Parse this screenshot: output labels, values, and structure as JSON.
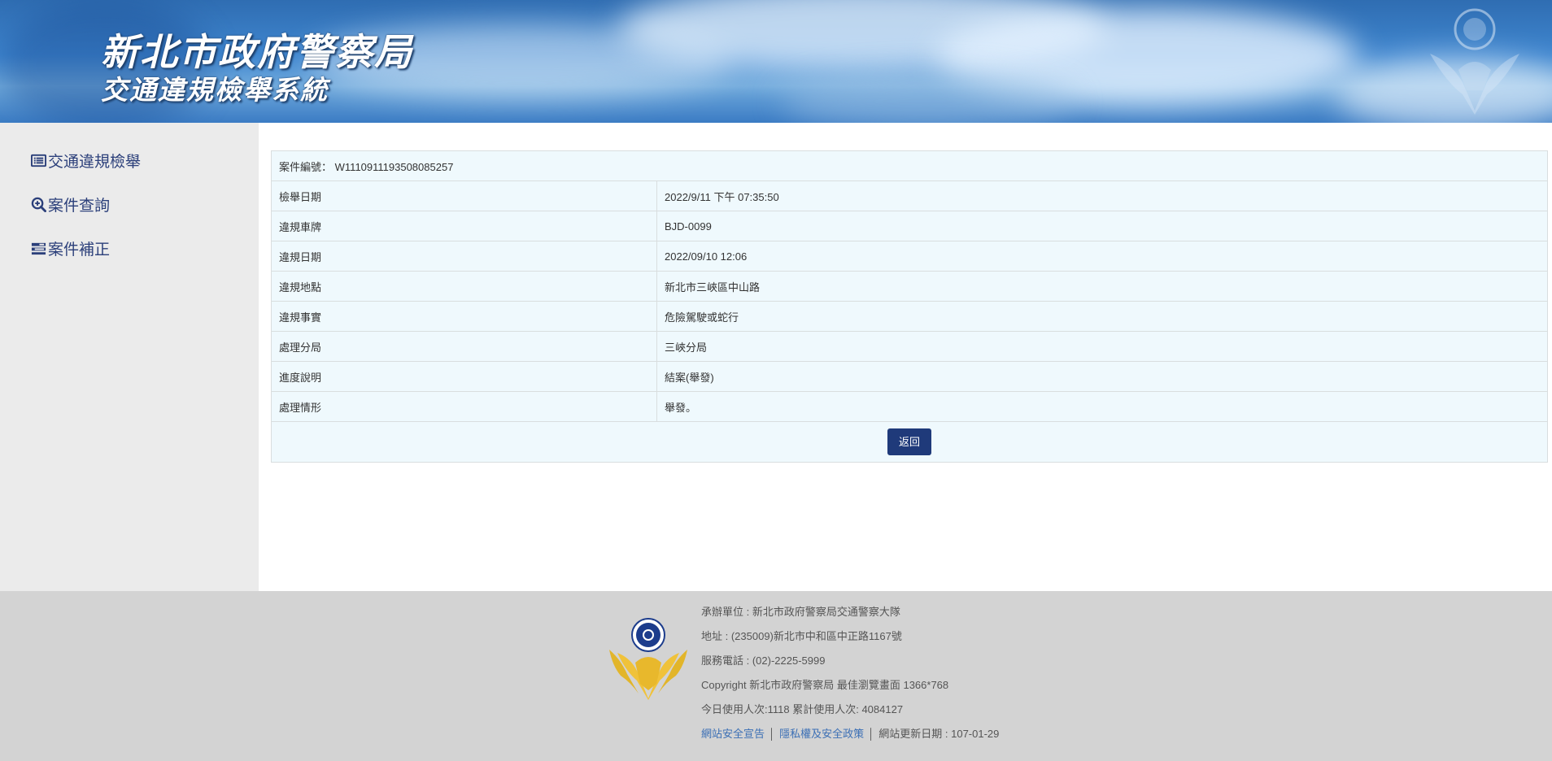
{
  "header": {
    "title": "新北市政府警察局",
    "subtitle": "交通違規檢舉系統"
  },
  "sidebar": {
    "items": [
      {
        "label": "交通違規檢舉",
        "icon": "list-icon"
      },
      {
        "label": "案件查詢",
        "icon": "search-plus-icon"
      },
      {
        "label": "案件補正",
        "icon": "tasks-icon"
      }
    ]
  },
  "case": {
    "number_label": "案件編號：",
    "number": "W1110911193508085257",
    "rows": [
      {
        "label": "檢舉日期",
        "value": "2022/9/11 下午 07:35:50"
      },
      {
        "label": "違規車牌",
        "value": "BJD-0099"
      },
      {
        "label": "違規日期",
        "value": "2022/09/10 12:06"
      },
      {
        "label": "違規地點",
        "value": "新北市三峽區中山路"
      },
      {
        "label": "違規事實",
        "value": "危險駕駛或蛇行"
      },
      {
        "label": "處理分局",
        "value": "三峽分局"
      },
      {
        "label": "進度說明",
        "value": "結案(舉發)"
      },
      {
        "label": "處理情形",
        "value": "舉發。"
      }
    ],
    "back_label": "返回"
  },
  "footer": {
    "organizer": "承辦單位 : 新北市政府警察局交通警察大隊",
    "address": "地址 : (235009)新北市中和區中正路1167號",
    "phone": "服務電話 : (02)-2225-5999",
    "copyright": "Copyright 新北市政府警察局 最佳瀏覽畫面 1366*768",
    "visits": "今日使用人次:1118 累計使用人次: 4084127",
    "link_security": "網站安全宣告",
    "link_privacy": "隱私權及安全政策",
    "updated": "網站更新日期 : 107-01-29"
  },
  "colors": {
    "nav_text": "#2b3f7a",
    "button_bg": "#1f3a7a",
    "table_bg": "#eff9fd",
    "link": "#3b6fb5"
  }
}
